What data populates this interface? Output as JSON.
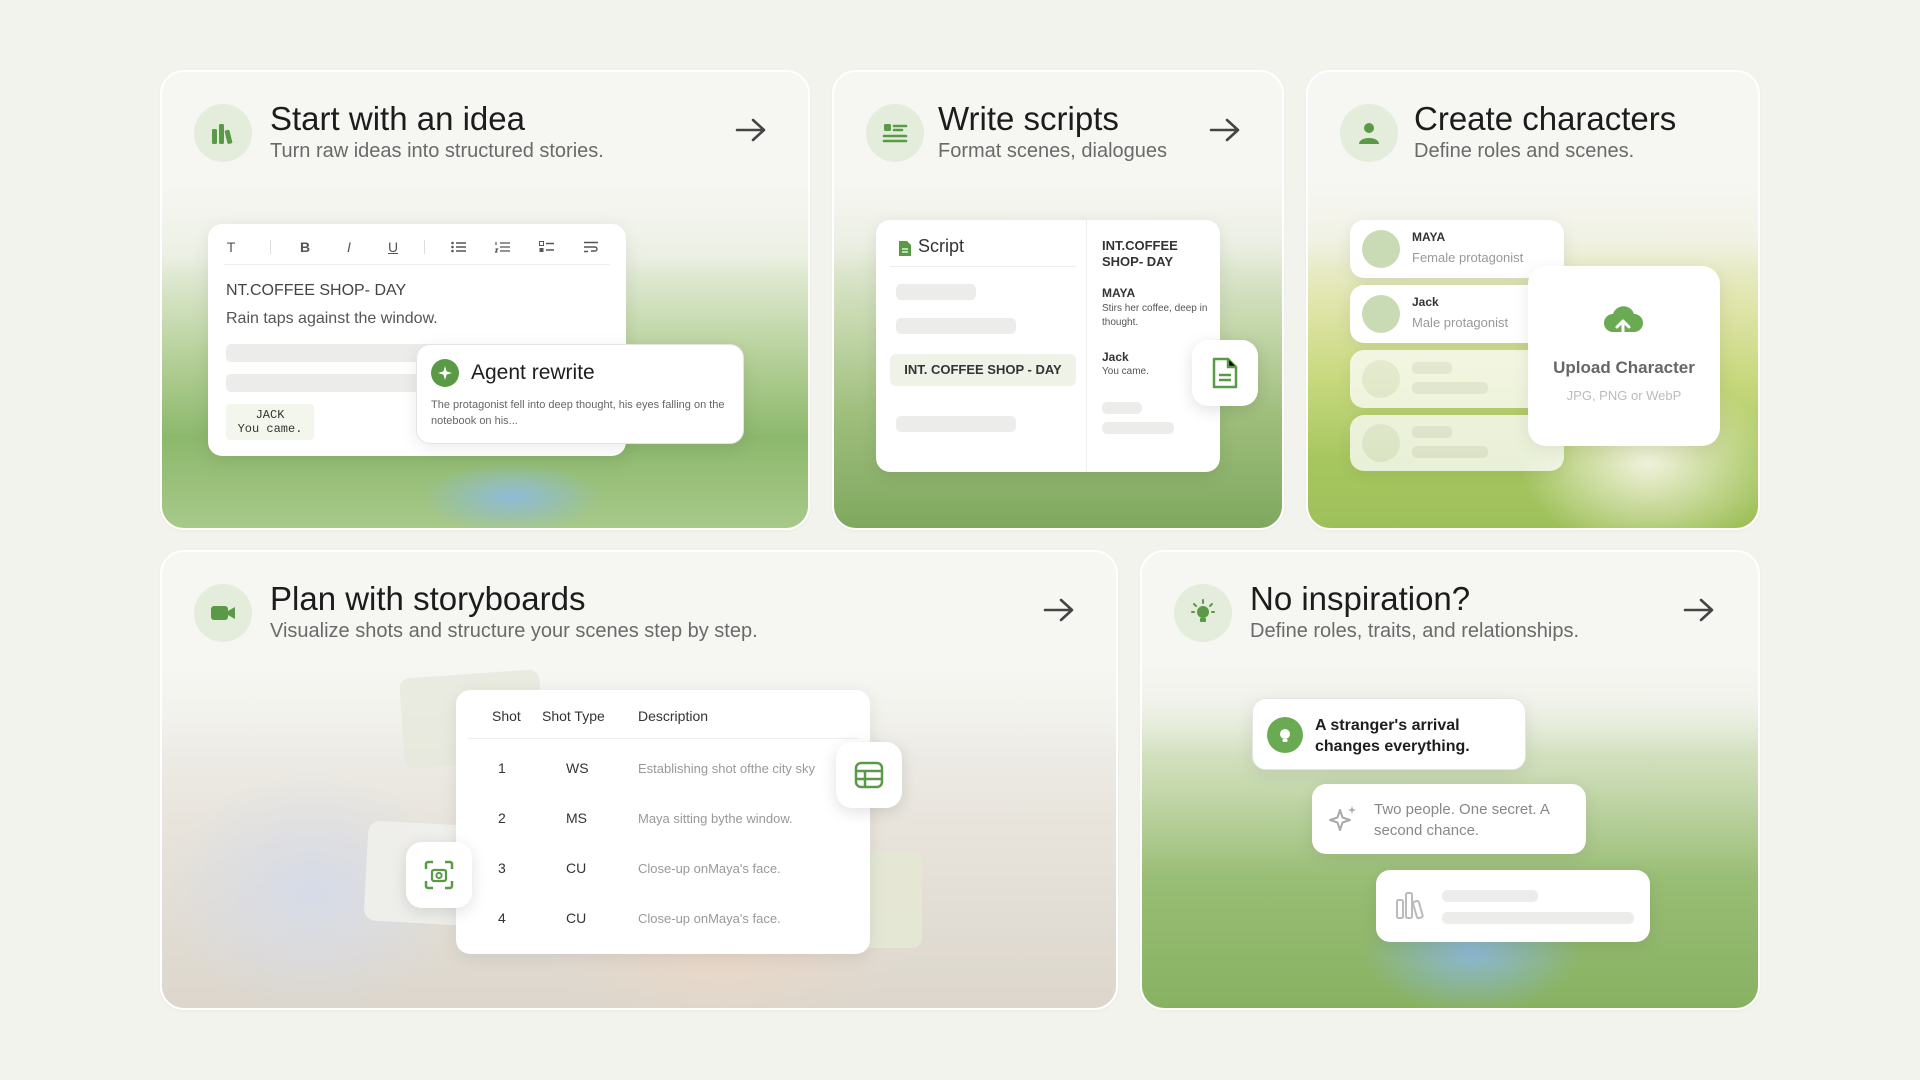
{
  "accent": "#5a9a46",
  "cards": {
    "idea": {
      "title": "Start with an idea",
      "subtitle": "Turn raw ideas into structured stories.",
      "icon": "bar-chart-icon",
      "editor": {
        "toolbar": [
          "T",
          "B",
          "I",
          "U",
          "bulleted-list-icon",
          "numbered-list-icon",
          "checklist-icon",
          "wrap-text-icon"
        ],
        "heading": "NT.COFFEE SHOP- DAY",
        "line": "Rain taps against the window.",
        "dialogue_name": "JACK",
        "dialogue_line": "You came."
      },
      "agent": {
        "title": "Agent rewrite",
        "text": "The protagonist fell into deep thought, his eyes falling on the notebook on his..."
      }
    },
    "scripts": {
      "title": "Write scripts",
      "subtitle": "Format scenes, dialogues",
      "icon": "script-lines-icon",
      "panel_title": "Script",
      "scene_tag": "INT. COFFEE SHOP - DAY",
      "right_heading": "INT.COFFEE SHOP- DAY",
      "lines": [
        {
          "name": "MAYA",
          "text": "Stirs her coffee, deep in thought."
        },
        {
          "name": "Jack",
          "text": "You came."
        }
      ]
    },
    "characters": {
      "title": "Create characters",
      "subtitle": "Define roles and scenes.",
      "icon": "person-icon",
      "list": [
        {
          "name": "MAYA",
          "role": "Female protagonist"
        },
        {
          "name": "Jack",
          "role": "Male protagonist"
        }
      ],
      "upload": {
        "title": "Upload Character",
        "hint": "JPG, PNG or WebP"
      }
    },
    "storyboards": {
      "title": "Plan with storyboards",
      "subtitle": "Visualize shots and structure your scenes step by step.",
      "icon": "video-camera-icon",
      "table": {
        "headers": [
          "Shot",
          "Shot Type",
          "Description"
        ],
        "rows": [
          {
            "shot": "1",
            "type": "WS",
            "desc": "Establishing shot ofthe city sky"
          },
          {
            "shot": "2",
            "type": "MS",
            "desc": "Maya sitting bythe window."
          },
          {
            "shot": "3",
            "type": "CU",
            "desc": "Close-up onMaya's face."
          },
          {
            "shot": "4",
            "type": "CU",
            "desc": "Close-up onMaya's face."
          }
        ]
      }
    },
    "inspiration": {
      "title": "No inspiration?",
      "subtitle": "Define roles, traits, and relationships.",
      "icon": "lightbulb-icon",
      "prompts": [
        {
          "text": "A stranger's arrival changes everything."
        },
        {
          "text": "Two people. One secret. A second chance."
        }
      ]
    }
  }
}
